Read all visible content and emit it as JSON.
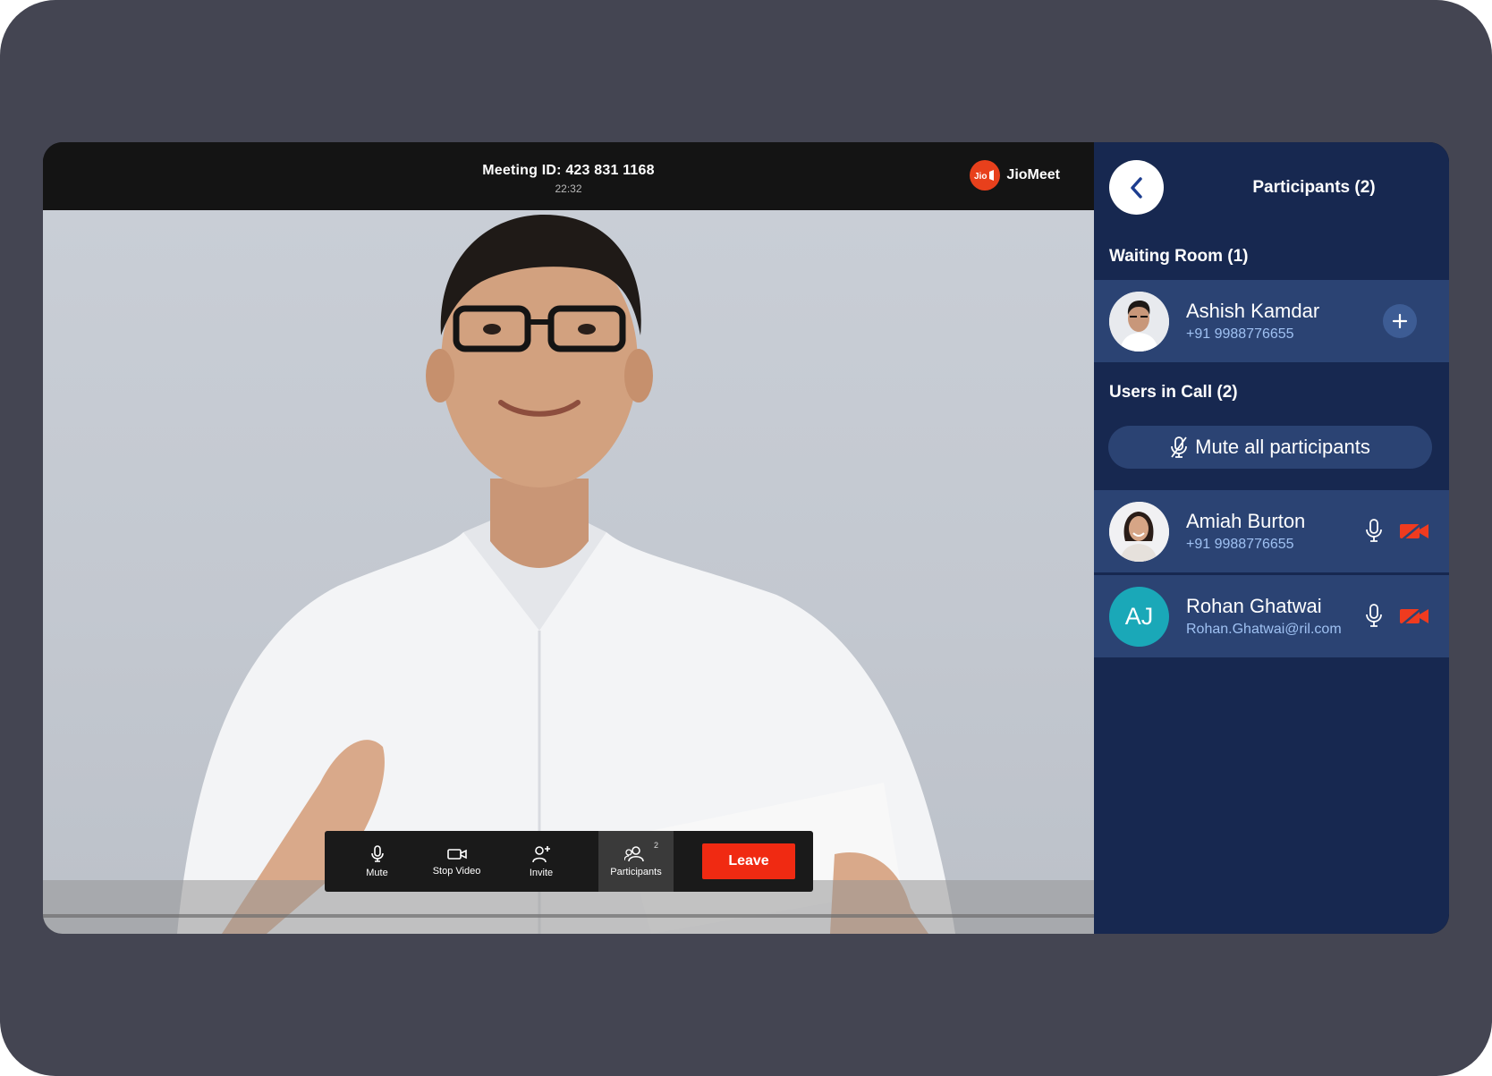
{
  "meeting": {
    "id_text": "Meeting ID: 423 831 1168",
    "elapsed": "22:32",
    "brand_logo_text": "Jio",
    "brand_name": "JioMeet"
  },
  "controls": {
    "mute_label": "Mute",
    "stop_video_label": "Stop Video",
    "invite_label": "Invite",
    "participants_label": "Participants",
    "participants_badge": "2",
    "leave_label": "Leave"
  },
  "panel": {
    "title": "Participants (2)",
    "waiting_room_title": "Waiting Room (1)",
    "users_in_call_title": "Users in Call (2)",
    "mute_all_label": "Mute all participants",
    "waiting": [
      {
        "name": "Ashish Kamdar",
        "sub": "+91 9988776655"
      }
    ],
    "in_call": [
      {
        "name": "Amiah Burton",
        "sub": "+91 9988776655"
      },
      {
        "name": "Rohan Ghatwai",
        "sub": "Rohan.Ghatwai@ril.com",
        "initials": "AJ"
      }
    ]
  },
  "colors": {
    "panel_bg": "#172850",
    "row_bg": "#2b4373",
    "leave": "#f02a12",
    "video_off": "#ef3b1f",
    "brand": "#e8401c"
  }
}
